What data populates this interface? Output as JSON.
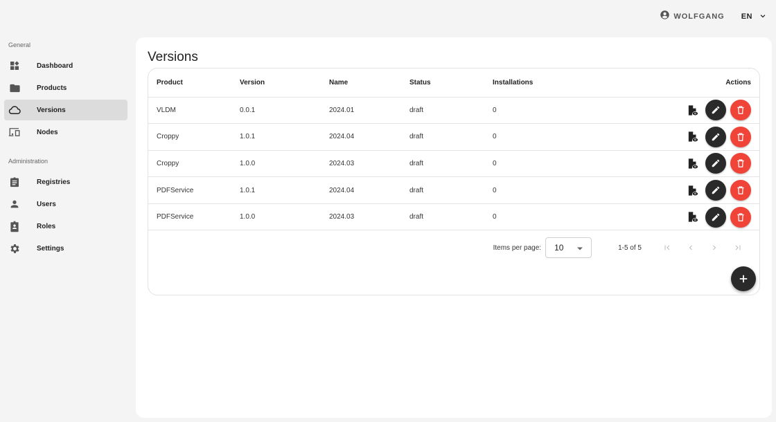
{
  "header": {
    "user": {
      "icon": "account-circle-icon",
      "name": "WOLFGANG"
    },
    "language": {
      "selected": "EN",
      "icon": "chevron-down-icon"
    }
  },
  "sidebar": {
    "sections": [
      {
        "label": "General",
        "items": [
          {
            "label": "Dashboard",
            "icon": "dashboard-icon",
            "active": false
          },
          {
            "label": "Products",
            "icon": "folder-icon",
            "active": false
          },
          {
            "label": "Versions",
            "icon": "cloud-icon",
            "active": true
          },
          {
            "label": "Nodes",
            "icon": "devices-icon",
            "active": false
          }
        ]
      },
      {
        "label": "Administration",
        "items": [
          {
            "label": "Registries",
            "icon": "clipboard-icon",
            "active": false
          },
          {
            "label": "Users",
            "icon": "person-icon",
            "active": false
          },
          {
            "label": "Roles",
            "icon": "badge-icon",
            "active": false
          },
          {
            "label": "Settings",
            "icon": "gear-icon",
            "active": false
          }
        ]
      }
    ]
  },
  "main": {
    "title": "Versions",
    "table": {
      "columns": [
        "Product",
        "Version",
        "Name",
        "Status",
        "Installations",
        "Actions"
      ],
      "rows": [
        {
          "product": "VLDM",
          "version": "0.0.1",
          "name": "2024.01",
          "status": "draft",
          "installations": "0"
        },
        {
          "product": "Croppy",
          "version": "1.0.1",
          "name": "2024.04",
          "status": "draft",
          "installations": "0"
        },
        {
          "product": "Croppy",
          "version": "1.0.0",
          "name": "2024.03",
          "status": "draft",
          "installations": "0"
        },
        {
          "product": "PDFService",
          "version": "1.0.1",
          "name": "2024.04",
          "status": "draft",
          "installations": "0"
        },
        {
          "product": "PDFService",
          "version": "1.0.0",
          "name": "2024.03",
          "status": "draft",
          "installations": "0"
        }
      ],
      "row_actions": [
        "view-icon",
        "edit-icon",
        "delete-icon"
      ]
    },
    "paginator": {
      "items_per_page_label": "Items per page:",
      "items_per_page": "10",
      "range": "1-5 of 5"
    },
    "fab_icon": "add-icon"
  },
  "colors": {
    "delete": "#f04438",
    "dark_button": "#2a2a2a",
    "active_nav": "#dcdcdc",
    "background": "#f4f4f4"
  }
}
